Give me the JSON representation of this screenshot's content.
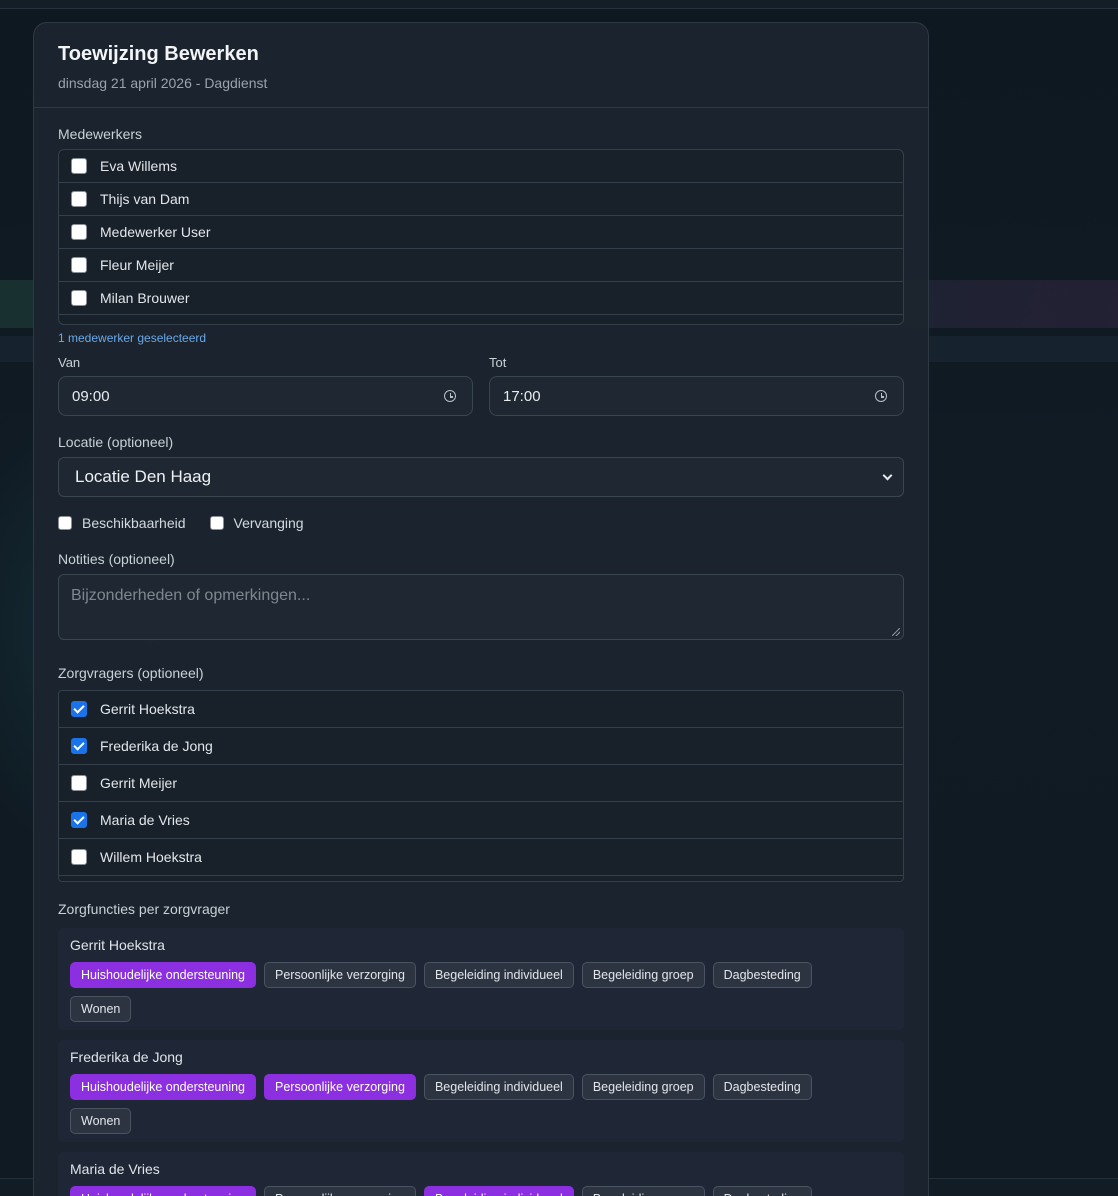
{
  "modal": {
    "title": "Toewijzing Bewerken",
    "subtitle": "dinsdag 21 april 2026 - Dagdienst"
  },
  "employees": {
    "label": "Medewerkers",
    "items": [
      {
        "name": "Eva Willems",
        "checked": false
      },
      {
        "name": "Thijs van Dam",
        "checked": false
      },
      {
        "name": "Medewerker User",
        "checked": false
      },
      {
        "name": "Fleur Meijer",
        "checked": false
      },
      {
        "name": "Milan Brouwer",
        "checked": false
      }
    ],
    "selected_text": "1 medewerker geselecteerd"
  },
  "time": {
    "from_label": "Van",
    "from_value": "09:00",
    "to_label": "Tot",
    "to_value": "17:00"
  },
  "location": {
    "label": "Locatie (optioneel)",
    "value": "Locatie Den Haag"
  },
  "flags": {
    "availability_label": "Beschikbaarheid",
    "availability_checked": false,
    "substitution_label": "Vervanging",
    "substitution_checked": false
  },
  "notes": {
    "label": "Notities (optioneel)",
    "placeholder": "Bijzonderheden of opmerkingen..."
  },
  "clients": {
    "label": "Zorgvragers (optioneel)",
    "items": [
      {
        "name": "Gerrit Hoekstra",
        "checked": true
      },
      {
        "name": "Frederika de Jong",
        "checked": true
      },
      {
        "name": "Gerrit Meijer",
        "checked": false
      },
      {
        "name": "Maria de Vries",
        "checked": true
      },
      {
        "name": "Willem Hoekstra",
        "checked": false
      }
    ]
  },
  "functions": {
    "label": "Zorgfuncties per zorgvrager",
    "options": [
      "Huishoudelijke ondersteuning",
      "Persoonlijke verzorging",
      "Begeleiding individueel",
      "Begeleiding groep",
      "Dagbesteding",
      "Wonen"
    ],
    "per_client": [
      {
        "name": "Gerrit Hoekstra",
        "active": [
          true,
          false,
          false,
          false,
          false,
          false
        ]
      },
      {
        "name": "Frederika de Jong",
        "active": [
          true,
          true,
          false,
          false,
          false,
          false
        ]
      },
      {
        "name": "Maria de Vries",
        "active": [
          true,
          false,
          true,
          false,
          false,
          false
        ]
      }
    ]
  },
  "colors": {
    "accent_purple": "#8b2fe0",
    "checkbox_blue": "#1a73e8",
    "helper_blue": "#6aa8e8"
  }
}
